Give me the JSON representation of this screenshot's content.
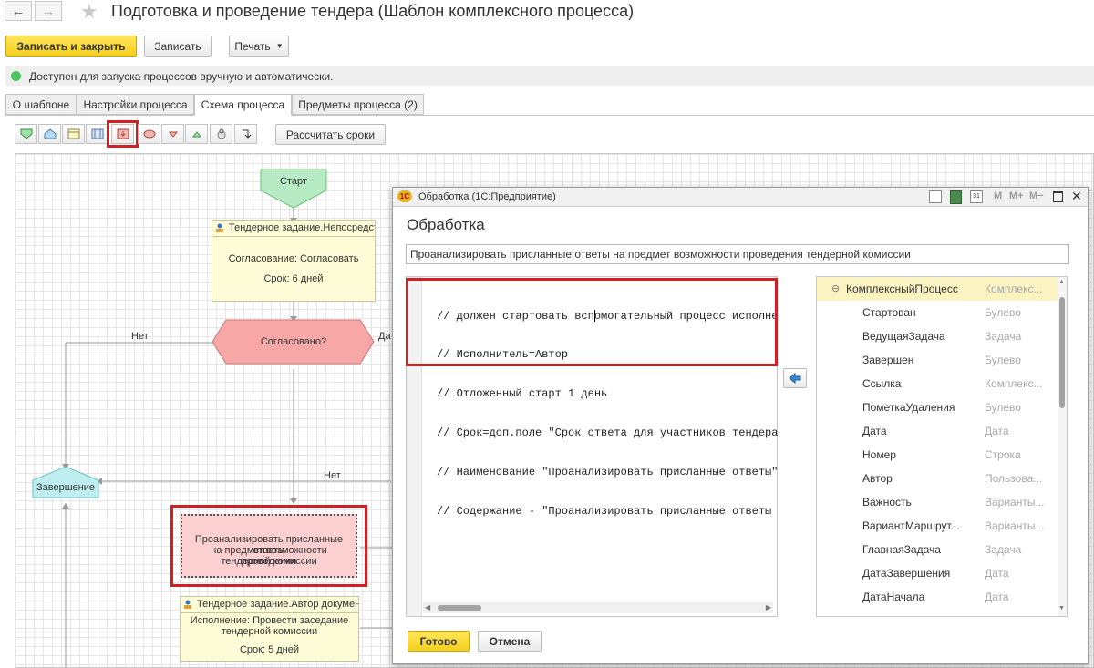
{
  "window": {
    "title": "Подготовка и проведение тендера (Шаблон комплексного процесса)"
  },
  "toolbar": {
    "save_close": "Записать и закрыть",
    "save": "Записать",
    "print": "Печать"
  },
  "info": {
    "text": "Доступен для запуска процессов вручную и автоматически.",
    "status_color": "#4fc45c"
  },
  "tabs": [
    "О шаблоне",
    "Настройки процесса",
    "Схема процесса",
    "Предметы процесса (2)"
  ],
  "active_tab": "Схема процесса",
  "schema_toolbar": {
    "calc_button": "Рассчитать сроки",
    "icons": [
      "start-shape-icon",
      "finish-shape-icon",
      "task-shape-icon",
      "subprocess-shape-icon",
      "processing-shape-icon",
      "activity-shape-icon",
      "condition-shape-icon",
      "split-shape-icon",
      "merge-shape-icon",
      "connector-icon"
    ]
  },
  "diagram": {
    "start": "Старт",
    "task1": {
      "header": "Тендерное задание.Непосредственны",
      "line1": "Согласование: Согласовать",
      "line2": "Срок: 6 дней"
    },
    "condition": "Согласовано?",
    "label_no1": "Нет",
    "label_yes": "Да",
    "label_no2": "Нет",
    "finish": "Завершение",
    "processing": {
      "line1": "Проанализировать присланные ответы",
      "line2": "на предмет возможности проведения",
      "line3": "тендерной комиссии"
    },
    "task2": {
      "header": "Тендерное задание.Автор документа",
      "line1": "Исполнение: Провести заседание",
      "line2": "тендерной комиссии",
      "line3": "Срок: 5 дней"
    }
  },
  "dialog": {
    "window_title": "Обработка  (1С:Предприятие)",
    "heading": "Обработка",
    "name_field": "Проанализировать присланные ответы на предмет возможности проведения тендерной комиссии",
    "code_lines": [
      "// должен стартовать вспомогательный процесс исполне",
      "// Исполнитель=Автор",
      "// Отложенный старт 1 день",
      "// Срок=доп.поле \"Срок ответа для участников тендера",
      "// Наименование \"Проанализировать присланные ответы\"",
      "// Содержание - \"Проанализировать присланные ответы "
    ],
    "tree": [
      {
        "name": "КомплексныйПроцесс",
        "type": "Комплекс..."
      },
      {
        "name": "Стартован",
        "type": "Булево"
      },
      {
        "name": "ВедущаяЗадача",
        "type": "Задача"
      },
      {
        "name": "Завершен",
        "type": "Булево"
      },
      {
        "name": "Ссылка",
        "type": "Комплекс..."
      },
      {
        "name": "ПометкаУдаления",
        "type": "Булево"
      },
      {
        "name": "Дата",
        "type": "Дата"
      },
      {
        "name": "Номер",
        "type": "Строка"
      },
      {
        "name": "Автор",
        "type": "Пользова..."
      },
      {
        "name": "Важность",
        "type": "Варианты..."
      },
      {
        "name": "ВариантМаршрут...",
        "type": "Варианты..."
      },
      {
        "name": "ГлавнаяЗадача",
        "type": "Задача"
      },
      {
        "name": "ДатаЗавершения",
        "type": "Дата"
      },
      {
        "name": "ДатаНачала",
        "type": "Дата"
      }
    ],
    "ok": "Готово",
    "cancel": "Отмена",
    "title_icons": [
      "1c-logo-icon",
      "print-icon",
      "calculator-icon",
      "calendar-icon",
      "memory-m-icon",
      "memory-mplus-icon",
      "memory-mminus-icon",
      "minimize-icon",
      "maximize-icon",
      "close-icon"
    ]
  }
}
